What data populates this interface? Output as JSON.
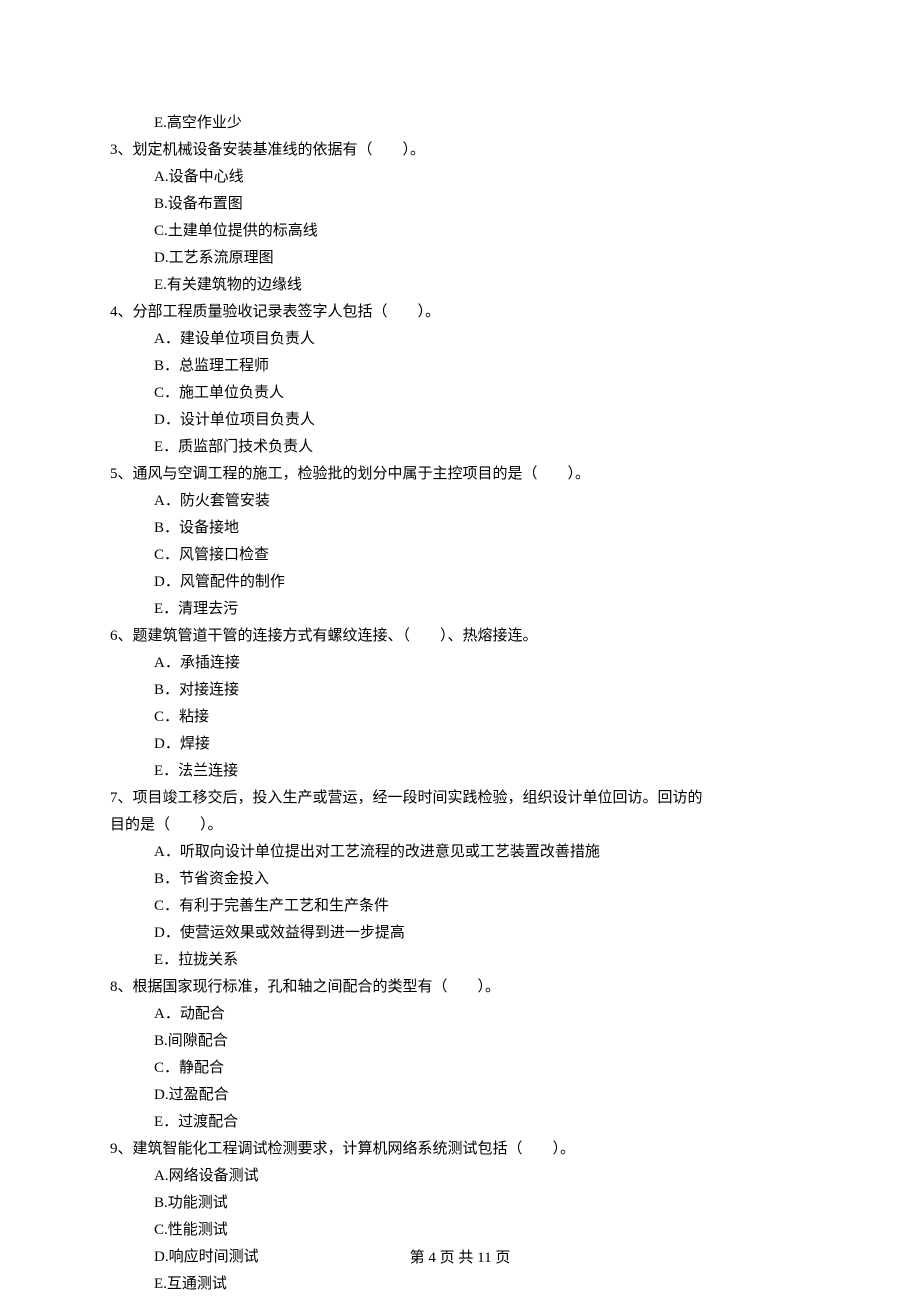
{
  "lines": {
    "q2_optE": "E.高空作业少",
    "q3_stem": "3、划定机械设备安装基准线的依据有（　　）。",
    "q3_optA": "A.设备中心线",
    "q3_optB": "B.设备布置图",
    "q3_optC": "C.土建单位提供的标高线",
    "q3_optD": "D.工艺系流原理图",
    "q3_optE": "E.有关建筑物的边缘线",
    "q4_stem": "4、分部工程质量验收记录表签字人包括（　　）。",
    "q4_optA": "A．建设单位项目负责人",
    "q4_optB": "B．总监理工程师",
    "q4_optC": "C．施工单位负责人",
    "q4_optD": "D．设计单位项目负责人",
    "q4_optE": "E．质监部门技术负责人",
    "q5_stem": "5、通风与空调工程的施工，检验批的划分中属于主控项目的是（　　）。",
    "q5_optA": "A．防火套管安装",
    "q5_optB": "B．设备接地",
    "q5_optC": "C．风管接口检查",
    "q5_optD": "D．风管配件的制作",
    "q5_optE": "E．清理去污",
    "q6_stem": "6、题建筑管道干管的连接方式有螺纹连接、（　　）、热熔接连。",
    "q6_optA": "A．承插连接",
    "q6_optB": "B．对接连接",
    "q6_optC": "C．粘接",
    "q6_optD": "D．焊接",
    "q6_optE": "E．法兰连接",
    "q7_stem_l1": "7、项目竣工移交后，投入生产或营运，经一段时间实践检验，组织设计单位回访。回访的",
    "q7_stem_l2": "目的是（　　）。",
    "q7_optA": "A．听取向设计单位提出对工艺流程的改进意见或工艺装置改善措施",
    "q7_optB": "B．节省资金投入",
    "q7_optC": "C．有利于完善生产工艺和生产条件",
    "q7_optD": "D．使营运效果或效益得到进一步提高",
    "q7_optE": "E．拉拢关系",
    "q8_stem": "8、根据国家现行标准，孔和轴之间配合的类型有（　　）。",
    "q8_optA": "A．动配合",
    "q8_optB": "B.间隙配合",
    "q8_optC": "C．静配合",
    "q8_optD": "D.过盈配合",
    "q8_optE": "E．过渡配合",
    "q9_stem": "9、建筑智能化工程调试检测要求，计算机网络系统测试包括（　　）。",
    "q9_optA": "A.网络设备测试",
    "q9_optB": "B.功能测试",
    "q9_optC": "C.性能测试",
    "q9_optD": "D.响应时间测试",
    "q9_optE": "E.互通测试"
  },
  "footer": "第 4 页 共 11 页"
}
